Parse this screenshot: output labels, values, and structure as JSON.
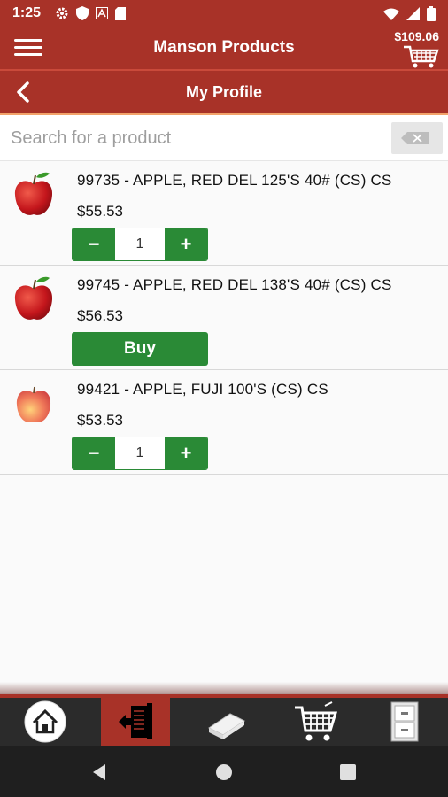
{
  "status_bar": {
    "time": "1:25",
    "icons": [
      "gear-icon",
      "shield-icon",
      "a-box-icon",
      "sd-card-icon",
      "wifi-icon",
      "signal-icon",
      "battery-icon"
    ]
  },
  "app_bar": {
    "title": "Manson Products",
    "cart_total": "$109.06"
  },
  "sub_header": {
    "title": "My Profile"
  },
  "search": {
    "placeholder": "Search for a product",
    "value": ""
  },
  "products": [
    {
      "name": "99735 - APPLE, RED DEL 125'S 40# (CS) CS",
      "price": "$55.53",
      "control": "stepper",
      "qty": "1",
      "minus": "−",
      "plus": "+",
      "image": "red-apple"
    },
    {
      "name": "99745 - APPLE, RED DEL 138'S 40# (CS) CS",
      "price": "$56.53",
      "control": "buy",
      "buy_label": "Buy",
      "image": "red-apple"
    },
    {
      "name": "99421 - APPLE, FUJI 100'S (CS) CS",
      "price": "$53.53",
      "control": "stepper",
      "qty": "1",
      "minus": "−",
      "plus": "+",
      "image": "fuji-apple"
    }
  ],
  "tab_bar": {
    "tabs": [
      {
        "icon": "home-icon",
        "active": false
      },
      {
        "icon": "order-list-icon",
        "active": true
      },
      {
        "icon": "book-icon",
        "active": false
      },
      {
        "icon": "cart-icon",
        "active": false
      },
      {
        "icon": "cabinet-icon",
        "active": false
      }
    ]
  },
  "colors": {
    "brand_red": "#a83228",
    "action_green": "#2a8a36",
    "tab_bar_dark": "#2b2b2b"
  }
}
